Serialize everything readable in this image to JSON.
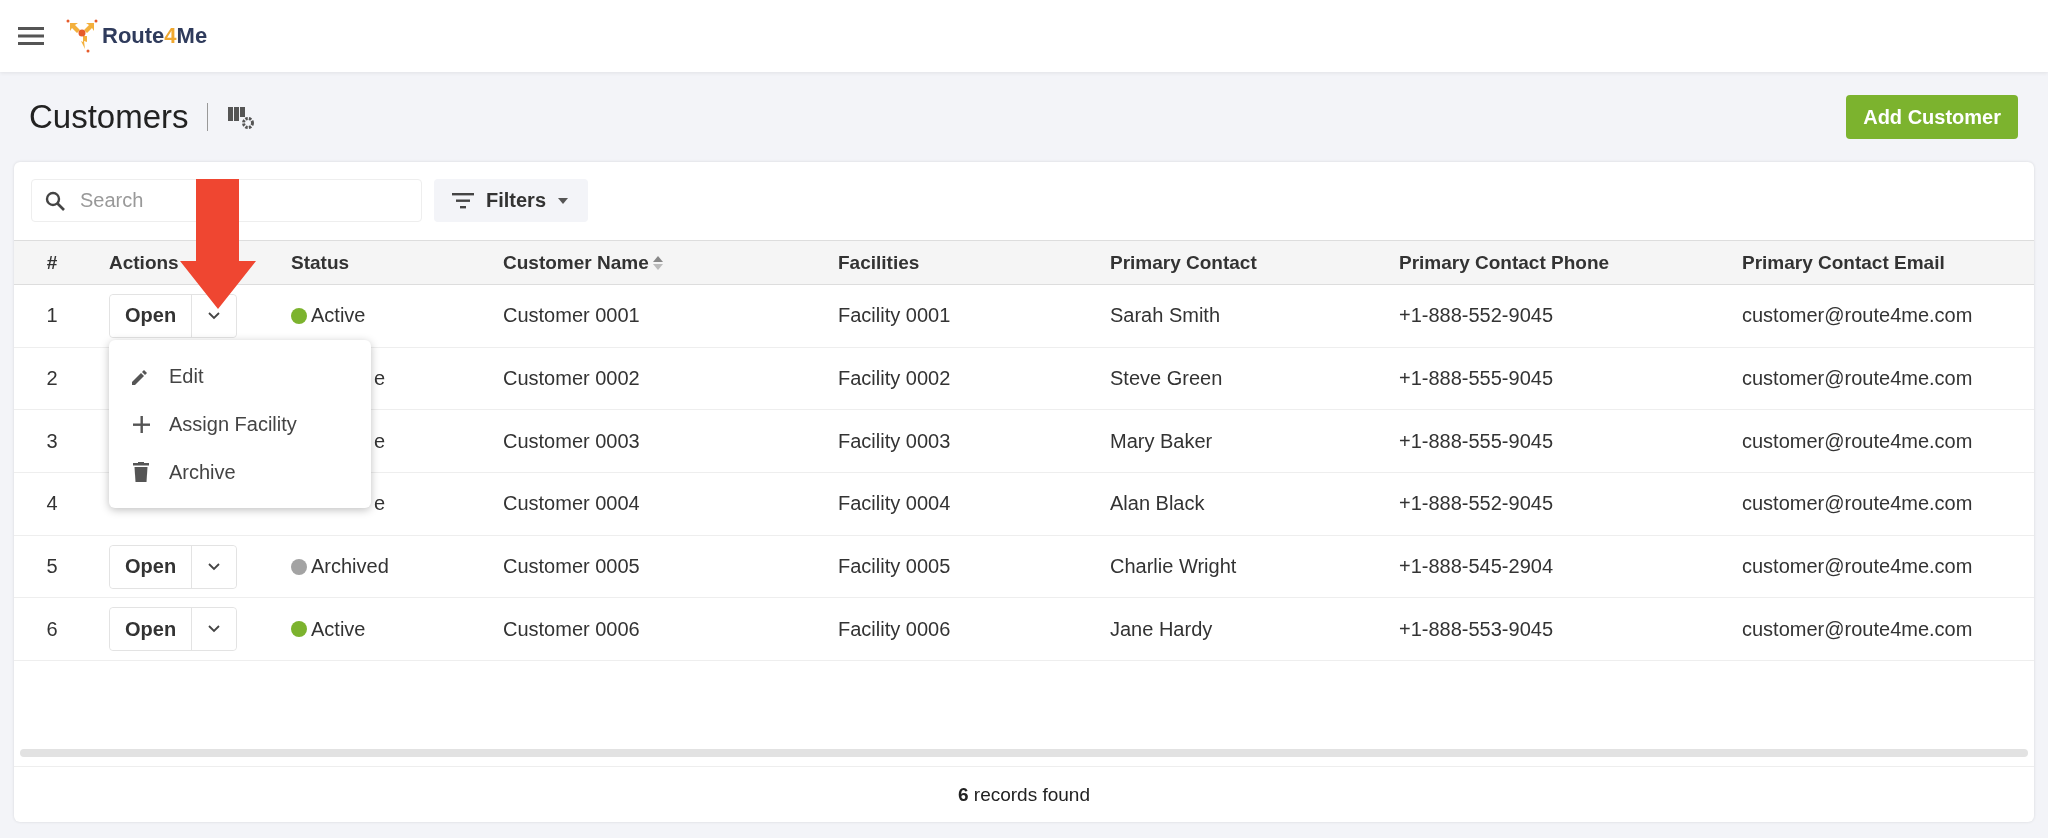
{
  "topbar": {
    "logo_parts": [
      "Route",
      "4",
      "Me"
    ]
  },
  "header": {
    "title": "Customers",
    "add_button": "Add Customer"
  },
  "toolbar": {
    "search": {
      "placeholder": "Search"
    },
    "filters": "Filters"
  },
  "table": {
    "columns": [
      {
        "label": "#",
        "sortable": false
      },
      {
        "label": "Actions",
        "sortable": false
      },
      {
        "label": "Status",
        "sortable": false
      },
      {
        "label": "Customer Name",
        "sortable": true
      },
      {
        "label": "Facilities",
        "sortable": false
      },
      {
        "label": "Primary Contact",
        "sortable": false
      },
      {
        "label": "Primary Contact Phone",
        "sortable": false
      },
      {
        "label": "Primary Contact Email",
        "sortable": false
      }
    ],
    "rows": [
      {
        "number": "1",
        "actions": {
          "open": "Open"
        },
        "status": {
          "label": "Active",
          "color": "#7cb32e",
          "covered": false
        },
        "name": "Customer 0001",
        "facility": "Facility 0001",
        "contact": "Sarah Smith",
        "phone": "+1-888-552-9045",
        "email": "customer@route4me.com"
      },
      {
        "number": "2",
        "status": {
          "label": "e",
          "covered": true
        },
        "name": "Customer 0002",
        "facility": "Facility 0002",
        "contact": "Steve Green",
        "phone": "+1-888-555-9045",
        "email": "customer@route4me.com"
      },
      {
        "number": "3",
        "status": {
          "label": "e",
          "covered": true
        },
        "name": "Customer 0003",
        "facility": "Facility 0003",
        "contact": "Mary Baker",
        "phone": "+1-888-555-9045",
        "email": "customer@route4me.com"
      },
      {
        "number": "4",
        "status": {
          "label": "e",
          "covered": true
        },
        "name": "Customer 0004",
        "facility": "Facility 0004",
        "contact": "Alan Black",
        "phone": "+1-888-552-9045",
        "email": "customer@route4me.com"
      },
      {
        "number": "5",
        "actions": {
          "open": "Open"
        },
        "status": {
          "label": "Archived",
          "color": "#a3a3a3",
          "covered": false
        },
        "name": "Customer 0005",
        "facility": "Facility 0005",
        "contact": "Charlie Wright",
        "phone": "+1-888-545-2904",
        "email": "customer@route4me.com"
      },
      {
        "number": "6",
        "actions": {
          "open": "Open"
        },
        "status": {
          "label": "Active",
          "color": "#7cb32e",
          "covered": false
        },
        "name": "Customer 0006",
        "facility": "Facility 0006",
        "contact": "Jane Hardy",
        "phone": "+1-888-553-9045",
        "email": "customer@route4me.com"
      }
    ],
    "menu": [
      {
        "kind": "edit",
        "label": "Edit"
      },
      {
        "kind": "add",
        "label": "Assign Facility"
      },
      {
        "kind": "delete",
        "label": "Archive"
      }
    ]
  },
  "footer": "**6** records found"
}
